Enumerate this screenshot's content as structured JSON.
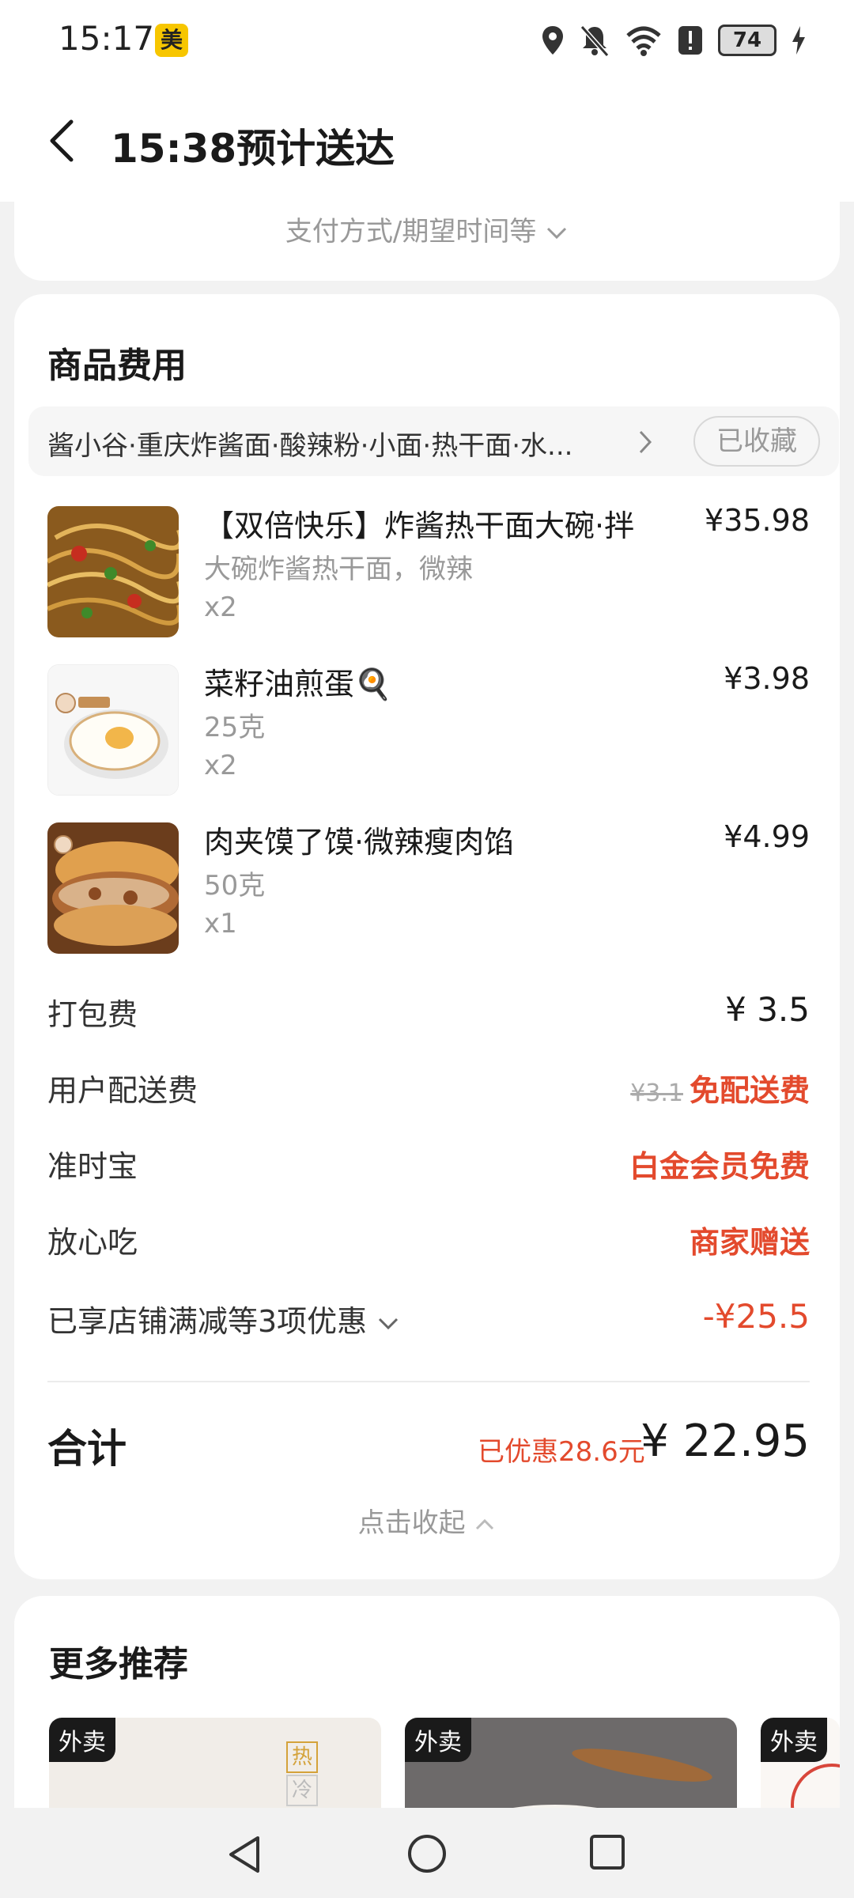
{
  "status_bar": {
    "time": "15:17",
    "app_badge": "美",
    "battery": "74"
  },
  "header": {
    "title": "15:38预计送达"
  },
  "top_card": {
    "hint": "支付方式/期望时间等"
  },
  "goods": {
    "section_title": "商品费用",
    "shop_name": "酱小谷·重庆炸酱面·酸辣粉·小面·热干面·水...",
    "fav_label": "已收藏",
    "items": [
      {
        "name": "【双倍快乐】炸酱热干面大碗·拌",
        "spec": "大碗炸酱热干面，微辣",
        "qty": "x2",
        "price": "¥35.98"
      },
      {
        "name": "菜籽油煎蛋🍳",
        "spec": "25克",
        "qty": "x2",
        "price": "¥3.98"
      },
      {
        "name": "肉夹馍了馍·微辣瘦肉馅",
        "spec": "50克",
        "qty": "x1",
        "price": "¥4.99"
      }
    ],
    "fees": {
      "packing_label": "打包费",
      "packing_value": "¥ 3.5",
      "delivery_label": "用户配送费",
      "delivery_original": "¥3.1",
      "delivery_value": "免配送费",
      "ontime_label": "准时宝",
      "ontime_value": "白金会员免费",
      "safe_label": "放心吃",
      "safe_value": "商家赠送",
      "discount_label": "已享店铺满减等3项优惠",
      "discount_value": "-¥25.5"
    },
    "total_label": "合计",
    "total_saved": "已优惠28.6元",
    "total_amount": "¥ 22.95",
    "collapse_label": "点击收起"
  },
  "recommend": {
    "title": "更多推荐",
    "cards": [
      {
        "tag": "外卖",
        "mark_1": "热",
        "mark_2": "冷"
      },
      {
        "tag": "外卖"
      },
      {
        "tag": "外卖"
      }
    ]
  },
  "colors": {
    "accent_red": "#e34a2d",
    "app_yellow": "#f7c600"
  }
}
